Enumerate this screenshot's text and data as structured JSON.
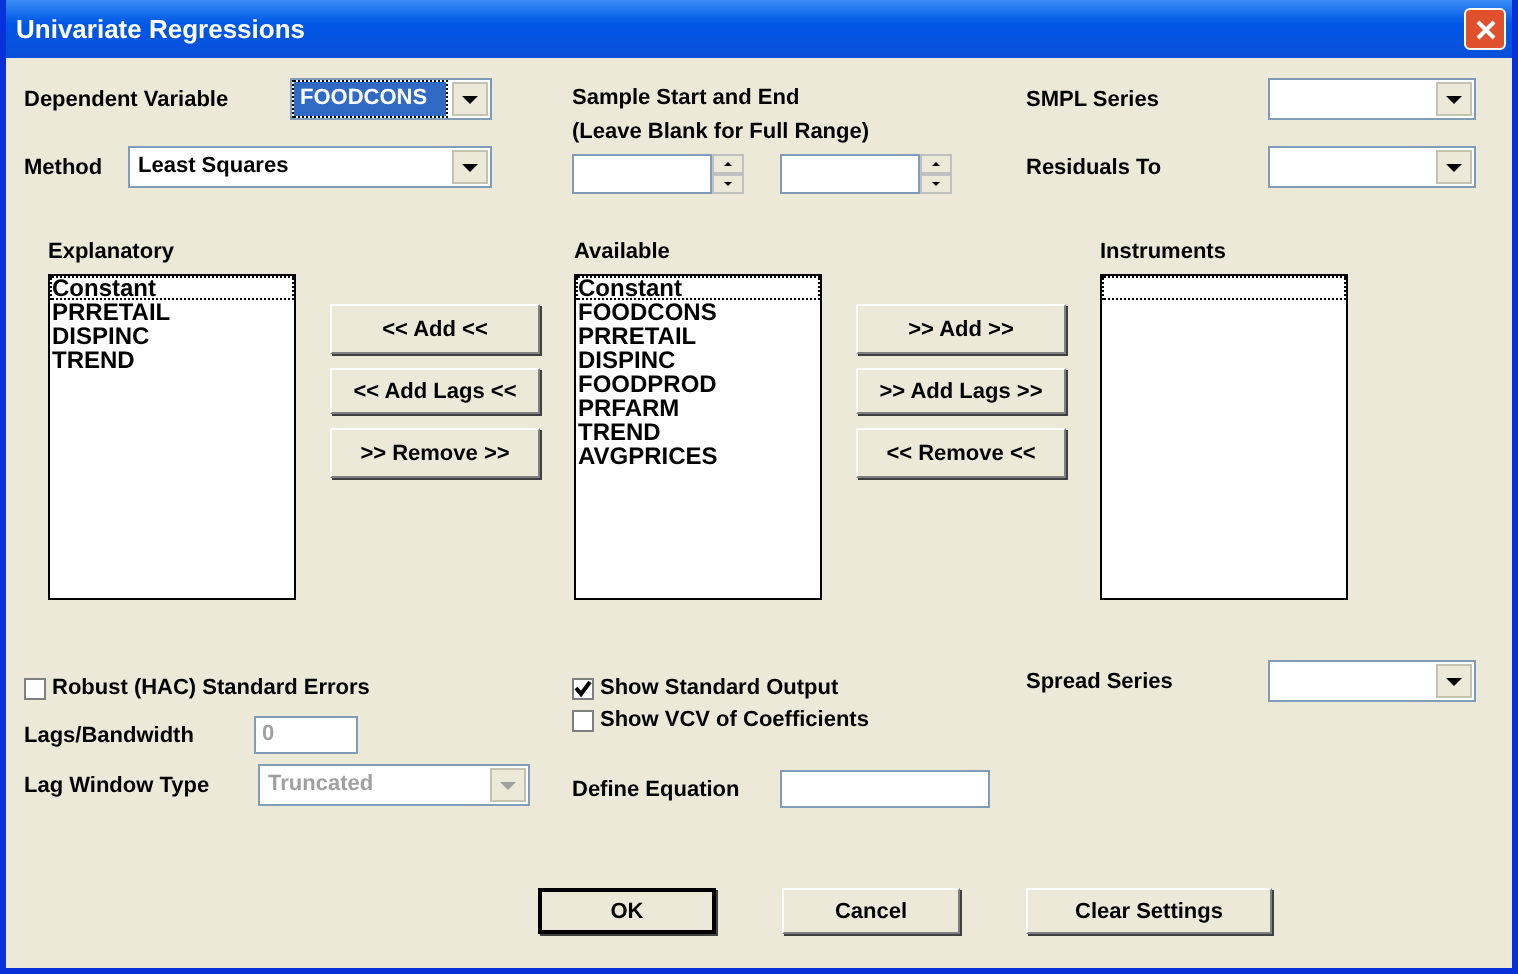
{
  "window": {
    "title": "Univariate Regressions"
  },
  "dependent_variable": {
    "label": "Dependent Variable",
    "value": "FOODCONS"
  },
  "method": {
    "label": "Method",
    "value": "Least Squares"
  },
  "sample": {
    "label": "Sample Start and End",
    "hint": "(Leave Blank for Full Range)"
  },
  "smpl_series": {
    "label": "SMPL Series"
  },
  "residuals_to": {
    "label": "Residuals To"
  },
  "lists": [
    {
      "label": "Explanatory",
      "items": [
        {
          "text": "Constant",
          "focused": true
        },
        {
          "text": "PRRETAIL",
          "focused": false
        },
        {
          "text": "DISPINC",
          "focused": false
        },
        {
          "text": "TREND",
          "focused": false
        }
      ]
    },
    {
      "label": "Available",
      "items": [
        {
          "text": "Constant",
          "focused": true
        },
        {
          "text": "FOODCONS",
          "focused": false
        },
        {
          "text": "PRRETAIL",
          "focused": false
        },
        {
          "text": "DISPINC",
          "focused": false
        },
        {
          "text": "FOODPROD",
          "focused": false
        },
        {
          "text": "PRFARM",
          "focused": false
        },
        {
          "text": "TREND",
          "focused": false
        },
        {
          "text": "AVGPRICES",
          "focused": false
        }
      ]
    },
    {
      "label": "Instruments"
    }
  ],
  "explanatory_buttons": [
    "<< Add <<",
    "<< Add Lags <<",
    ">> Remove >>"
  ],
  "instrument_buttons": [
    ">> Add >>",
    ">> Add Lags >>",
    "<< Remove <<"
  ],
  "robust": {
    "label": "Robust (HAC) Standard Errors",
    "checked": false
  },
  "lags_bandwidth": {
    "label": "Lags/Bandwidth",
    "value": "0",
    "disabled": true
  },
  "lag_window_type": {
    "label": "Lag Window Type",
    "value": "Truncated",
    "disabled": true
  },
  "show_standard_output": {
    "label": "Show Standard Output",
    "checked": true
  },
  "show_vcv": {
    "label": "Show VCV of Coefficients",
    "checked": false
  },
  "define_equation": {
    "label": "Define Equation"
  },
  "spread_series": {
    "label": "Spread Series"
  },
  "buttons": [
    {
      "label": "OK",
      "default": true
    },
    {
      "label": "Cancel",
      "default": false
    },
    {
      "label": "Clear Settings",
      "default": false
    }
  ]
}
